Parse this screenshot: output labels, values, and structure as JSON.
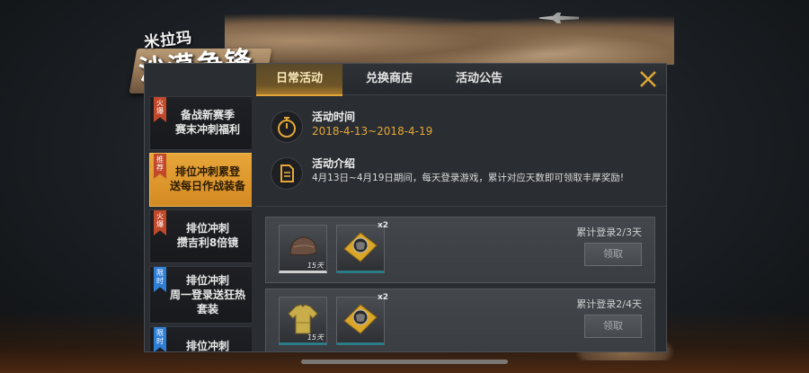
{
  "logo": {
    "small": "米拉玛",
    "big": "沙漠争锋"
  },
  "tabs": [
    {
      "label": "日常活动",
      "active": true
    },
    {
      "label": "兑换商店",
      "active": false
    },
    {
      "label": "活动公告",
      "active": false
    }
  ],
  "sidebar": {
    "items": [
      {
        "flag": "火爆",
        "flag_color": "red",
        "line1": "备战新赛季",
        "line2": "赛末冲刺福利",
        "line3": "",
        "active": false
      },
      {
        "flag": "推荐",
        "flag_color": "red",
        "line1": "排位冲刺累登",
        "line2": "送每日作战装备",
        "line3": "",
        "active": true
      },
      {
        "flag": "火爆",
        "flag_color": "red",
        "line1": "排位冲刺",
        "line2": "攒吉利8倍镜",
        "line3": "",
        "active": false
      },
      {
        "flag": "限时",
        "flag_color": "blue",
        "line1": "排位冲刺",
        "line2": "周一登录送狂热",
        "line3": "套装",
        "active": false
      },
      {
        "flag": "限时",
        "flag_color": "blue",
        "line1": "排位冲刺",
        "line2": "",
        "line3": "",
        "active": false
      }
    ]
  },
  "activity": {
    "time_title": "活动时间",
    "time_value": "2018-4-13~2018-4-19",
    "intro_title": "活动介绍",
    "intro_text": "4月13日~4月19日期间，每天登录游戏，累计对应天数即可领取丰厚奖励!"
  },
  "rewards": [
    {
      "progress": "累计登录2/3天",
      "claim_label": "领取",
      "items": [
        {
          "name": "helmet-item",
          "label": "15天",
          "qty": ""
        },
        {
          "name": "coupon-item",
          "label": "",
          "qty": "x2"
        }
      ]
    },
    {
      "progress": "累计登录2/4天",
      "claim_label": "领取",
      "items": [
        {
          "name": "shirt-item",
          "label": "15天",
          "qty": ""
        },
        {
          "name": "coupon-item",
          "label": "",
          "qty": "x2"
        }
      ]
    }
  ],
  "colors": {
    "accent": "#e4a738",
    "active_tab": "#a57a2c",
    "flag_red": "#c2482a",
    "flag_blue": "#2f7ed6"
  }
}
